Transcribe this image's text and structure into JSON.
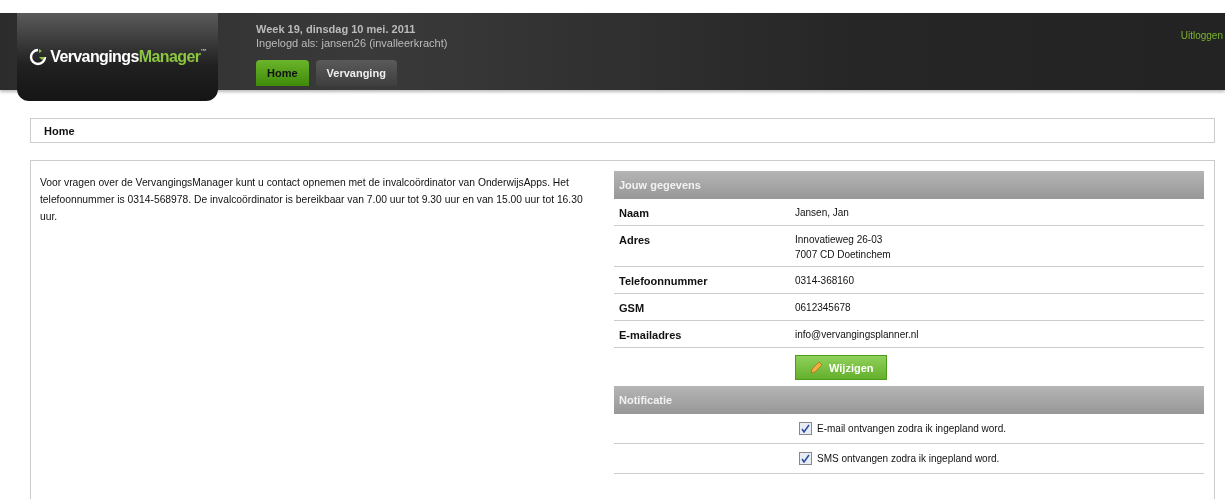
{
  "header": {
    "logo": {
      "first": "Vervangings",
      "second": "Manager",
      "mark": "™"
    },
    "date": "Week 19, dinsdag 10 mei. 2011",
    "user": "Ingelogd als: jansen26 (invalleerkracht)",
    "logout": "Uitloggen"
  },
  "tabs": [
    {
      "label": "Home",
      "selected": true
    },
    {
      "label": "Vervanging",
      "selected": false
    }
  ],
  "breadcrumb": "Home",
  "intro": "Voor vragen over de VervangingsManager kunt u contact opnemen met de invalcoördinator van OnderwijsApps. Het telefoonnummer is 0314-568978. De invalcoördinator is bereikbaar van 7.00 uur tot 9.30 uur en van 15.00 uur tot 16.30 uur.",
  "details": {
    "title": "Jouw gegevens",
    "rows": [
      {
        "label": "Naam",
        "values": [
          "Jansen, Jan"
        ]
      },
      {
        "label": "Adres",
        "values": [
          "Innovatieweg 26-03",
          "7007 CD Doetinchem"
        ]
      },
      {
        "label": "Telefoonnummer",
        "values": [
          "0314-368160"
        ]
      },
      {
        "label": "GSM",
        "values": [
          "0612345678"
        ]
      },
      {
        "label": "E-mailadres",
        "values": [
          "info@vervangingsplanner.nl"
        ]
      }
    ],
    "button": "Wijzigen"
  },
  "notifications": {
    "title": "Notificatie",
    "options": [
      {
        "label": "E-mail ontvangen zodra ik ingepland word.",
        "checked": true
      },
      {
        "label": "SMS ontvangen zodra ik ingepland word.",
        "checked": true
      }
    ]
  }
}
